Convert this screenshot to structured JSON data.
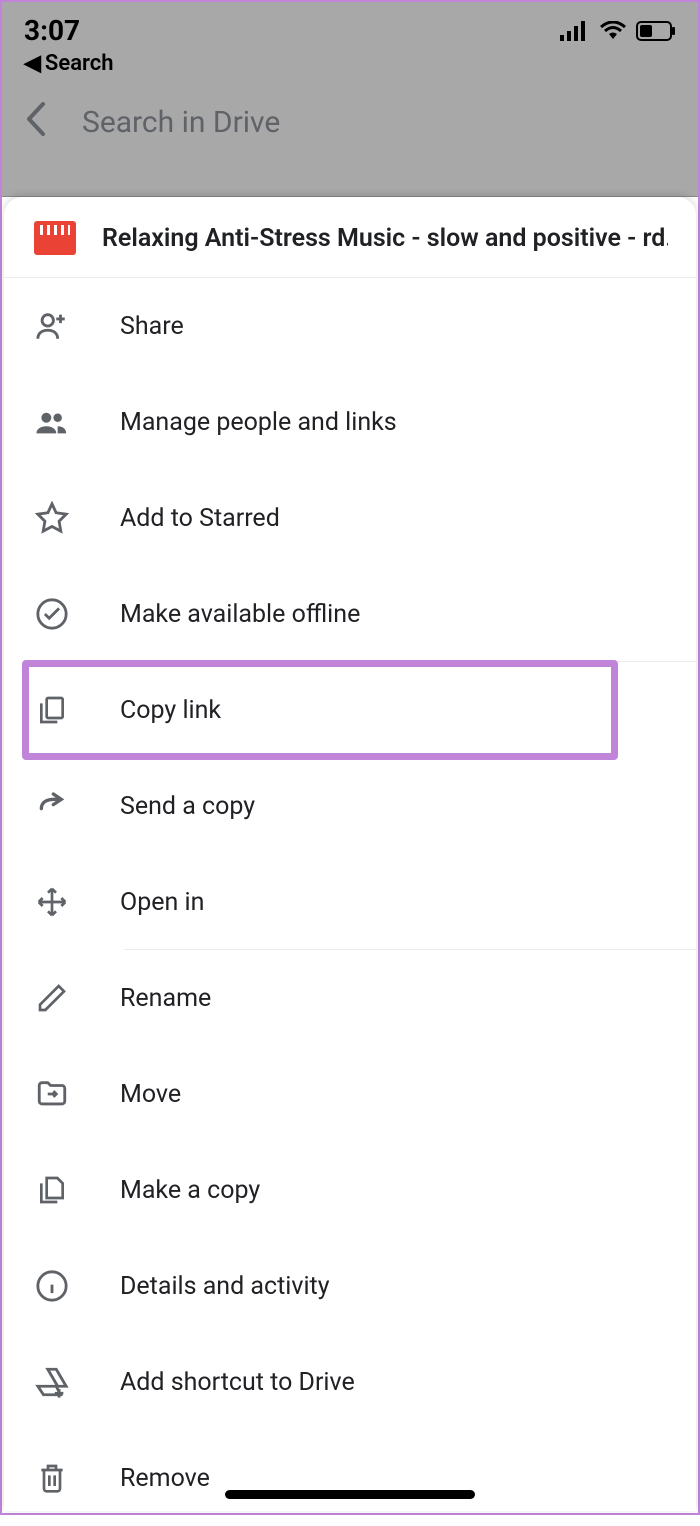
{
  "status": {
    "time": "3:07",
    "back_label": "Search"
  },
  "header": {
    "search_placeholder": "Search in Drive"
  },
  "file": {
    "title": "Relaxing Anti-Stress Music - slow and positive - rd..."
  },
  "menu": {
    "share": "Share",
    "manage_people": "Manage people and links",
    "starred": "Add to Starred",
    "offline": "Make available offline",
    "copy_link": "Copy link",
    "send_copy": "Send a copy",
    "open_in": "Open in",
    "rename": "Rename",
    "move": "Move",
    "make_copy": "Make a copy",
    "details": "Details and activity",
    "add_shortcut": "Add shortcut to Drive",
    "remove": "Remove"
  }
}
